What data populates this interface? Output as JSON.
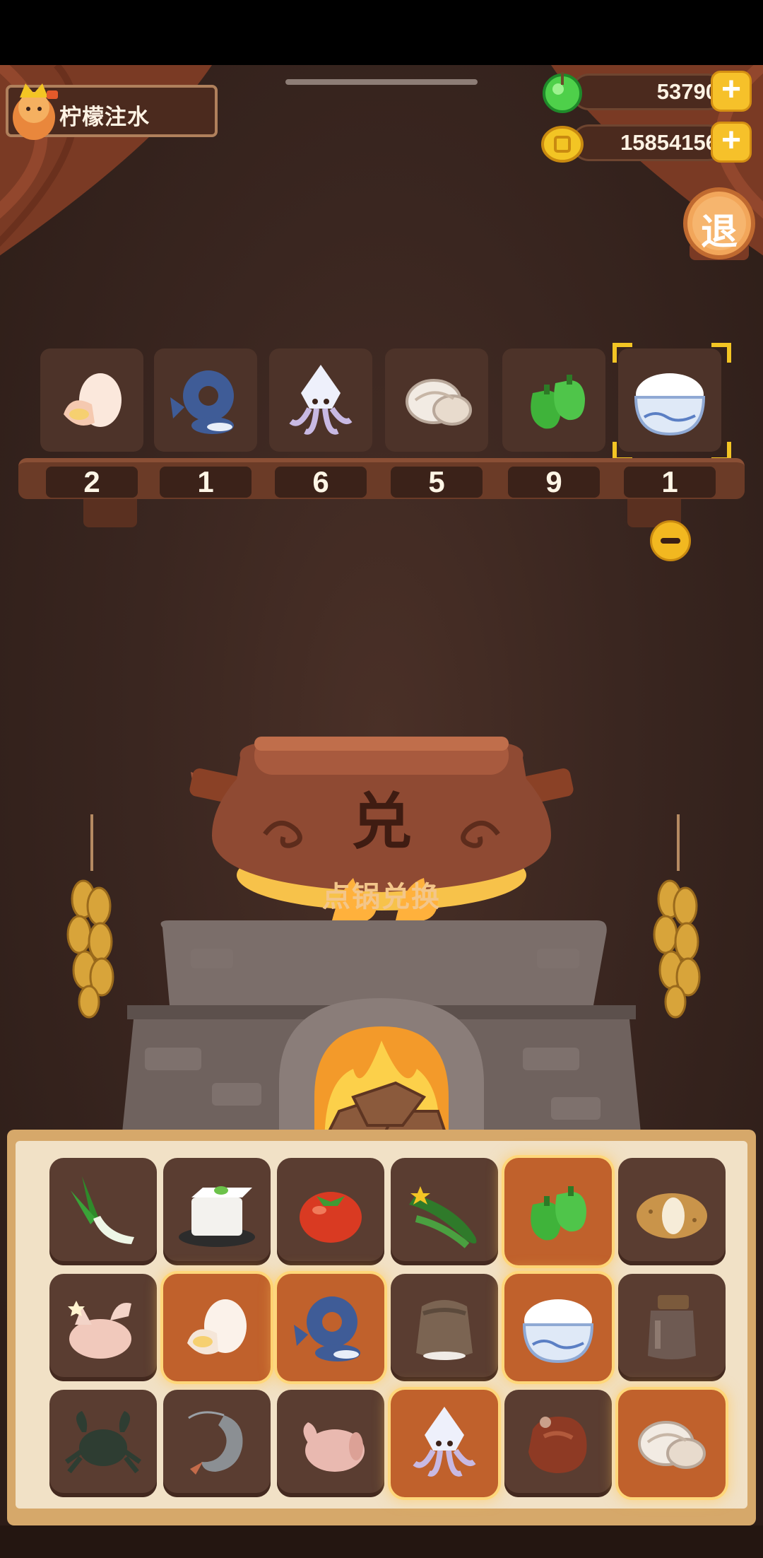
{
  "player": {
    "name": "柠檬注水"
  },
  "currency": {
    "gems": "53790",
    "coins": "15854156"
  },
  "exit_button": {
    "label": "退"
  },
  "shelf": {
    "slots": [
      {
        "icon": "egg-icon",
        "count": "2"
      },
      {
        "icon": "fish-icon",
        "count": "1"
      },
      {
        "icon": "squid-icon",
        "count": "6"
      },
      {
        "icon": "clam-icon",
        "count": "5"
      },
      {
        "icon": "green-pepper-icon",
        "count": "9"
      },
      {
        "icon": "rice-bowl-icon",
        "count": "1"
      }
    ],
    "selected_index": 5
  },
  "pot": {
    "character": "兑",
    "action_label": "点锅兑换"
  },
  "inventory": {
    "items": [
      {
        "icon": "leek-icon",
        "active": false
      },
      {
        "icon": "tofu-icon",
        "active": false
      },
      {
        "icon": "tomato-icon",
        "active": false
      },
      {
        "icon": "cucumber-icon",
        "active": false
      },
      {
        "icon": "green-pepper-icon",
        "active": true
      },
      {
        "icon": "potato-icon",
        "active": false
      },
      {
        "icon": "chicken-icon",
        "active": false
      },
      {
        "icon": "egg-icon",
        "active": true
      },
      {
        "icon": "fish-icon",
        "active": true
      },
      {
        "icon": "flour-sack-icon",
        "active": false
      },
      {
        "icon": "rice-bowl-icon",
        "active": true
      },
      {
        "icon": "jar-icon",
        "active": false
      },
      {
        "icon": "crab-icon",
        "active": false
      },
      {
        "icon": "shrimp-icon",
        "active": false
      },
      {
        "icon": "duck-icon",
        "active": false
      },
      {
        "icon": "squid-icon",
        "active": true
      },
      {
        "icon": "meat-icon",
        "active": false
      },
      {
        "icon": "clam-icon",
        "active": true
      }
    ]
  }
}
